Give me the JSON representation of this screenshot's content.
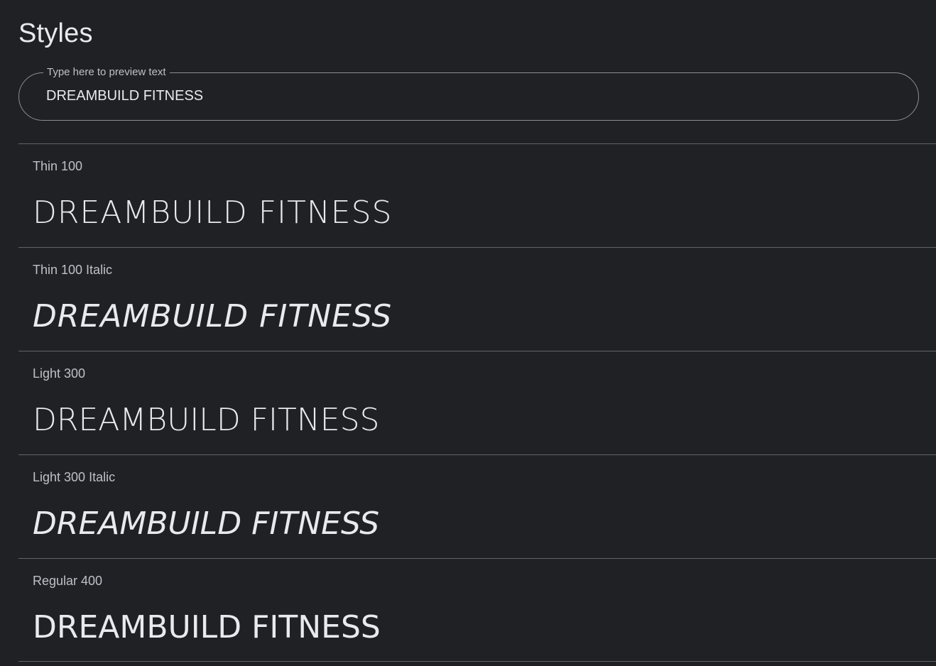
{
  "page": {
    "title": "Styles"
  },
  "preview": {
    "label": "Type here to preview text",
    "value": "DREAMBUILD FITNESS"
  },
  "styles": [
    {
      "name": "Thin 100",
      "sample": "DREAMBUILD FITNESS"
    },
    {
      "name": "Thin 100 Italic",
      "sample": "DREAMBUILD FITNESS"
    },
    {
      "name": "Light 300",
      "sample": "DREAMBUILD FITNESS"
    },
    {
      "name": "Light 300 Italic",
      "sample": "DREAMBUILD FITNESS"
    },
    {
      "name": "Regular 400",
      "sample": "DREAMBUILD FITNESS"
    }
  ],
  "colors": {
    "background": "#202124",
    "text": "#e8eaed",
    "muted_text": "#bdc1c6",
    "divider": "#5f6368",
    "field_border": "#8b8e93"
  }
}
